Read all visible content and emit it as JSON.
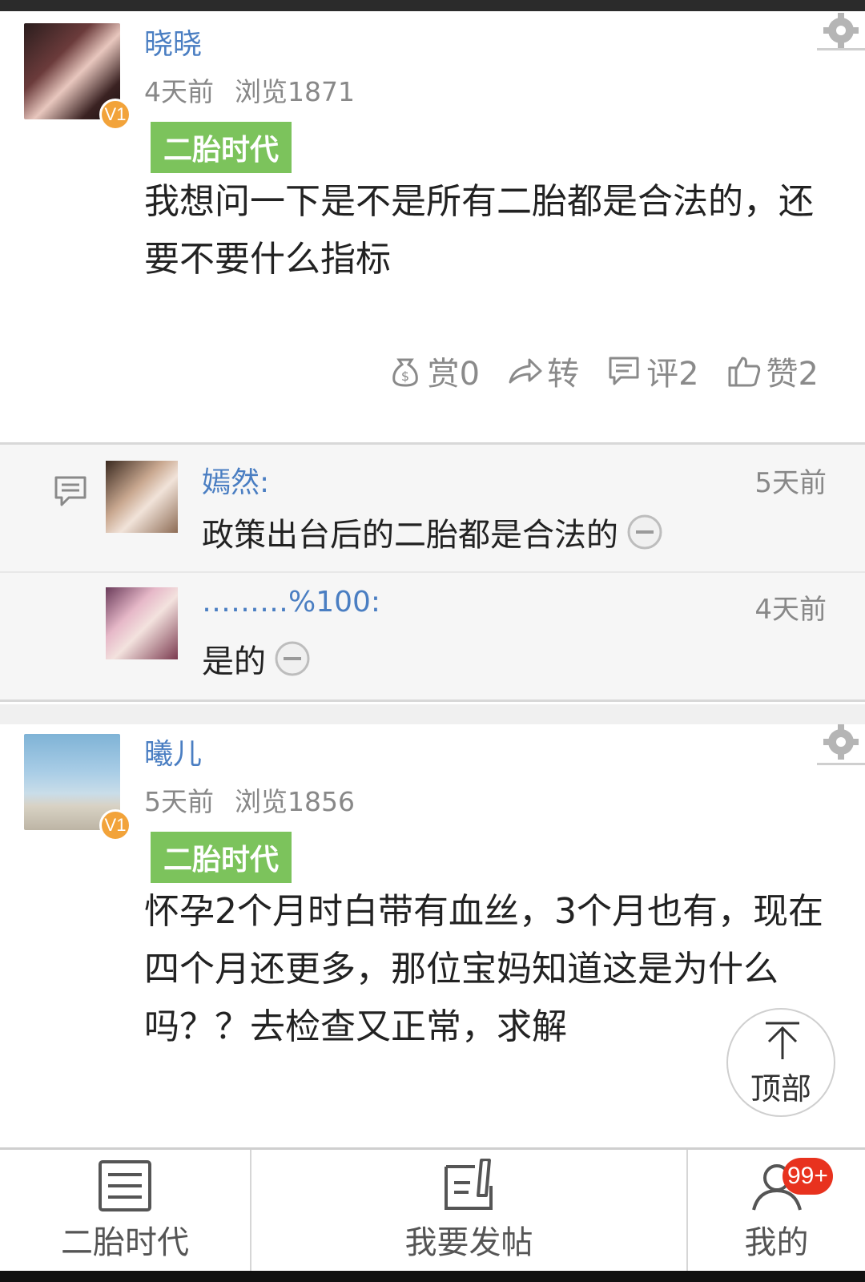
{
  "post1": {
    "username": "晓晓",
    "time": "4天前",
    "views": "浏览1871",
    "level_badge": "V1",
    "tag": "二胎时代",
    "content": "我想问一下是不是所有二胎都是合法的，还要不要什么指标",
    "actions": {
      "reward": "赏0",
      "share": "转",
      "comment": "评2",
      "like": "赞2"
    },
    "comments": [
      {
        "name": "嫣然:",
        "time": "5天前",
        "text": "政策出台后的二胎都是合法的"
      },
      {
        "name": "………%100:",
        "time": "4天前",
        "text": "是的"
      }
    ]
  },
  "post2": {
    "username": "曦儿",
    "time": "5天前",
    "views": "浏览1856",
    "level_badge": "V1",
    "tag": "二胎时代",
    "content": "怀孕2个月时白带有血丝，3个月也有，现在四个月还更多，那位宝妈知道这是为什么吗？？去检查又正常，求解"
  },
  "back_to_top": "顶部",
  "bottom_nav": {
    "forum": "二胎时代",
    "post": "我要发帖",
    "mine": "我的",
    "mine_badge": "99+"
  },
  "icons": {
    "gear": "settings-gear-icon",
    "reward": "money-bag-icon",
    "share": "share-arrow-icon",
    "comment": "comment-icon",
    "like": "thumbs-up-icon",
    "collapse": "minus-circle-icon",
    "top": "arrow-up-icon",
    "forum": "list-icon",
    "post": "edit-icon",
    "mine": "user-icon"
  },
  "colors": {
    "link": "#4a7ec2",
    "tag": "#7cc35c",
    "badge": "#f2a33a",
    "notify": "#e8321e"
  }
}
